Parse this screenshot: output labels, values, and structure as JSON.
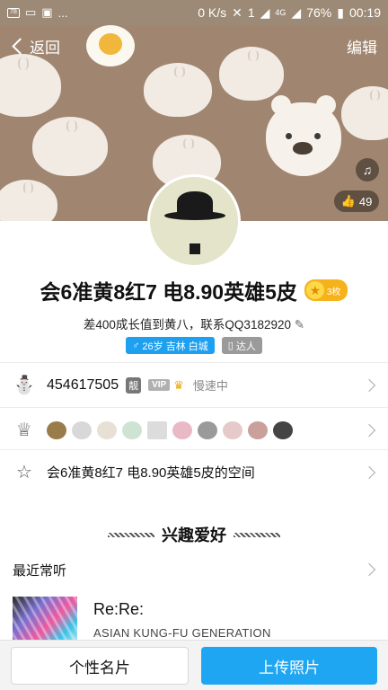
{
  "statusbar": {
    "net_speed": "0 K/s",
    "battery": "76%",
    "time": "00:19",
    "notif_count": "78",
    "ellipsis": "...",
    "sim_badge": "1",
    "net_type": "4G"
  },
  "nav": {
    "back_label": "返回",
    "edit_label": "编辑"
  },
  "cover": {
    "likes": "49"
  },
  "profile": {
    "name": "会6准黄8红7  电8.90英雄5皮",
    "medal_count": "3枚",
    "growth_text": "差400成长值到黄八，联系QQ3182920",
    "age_location": "26岁 吉林 白城",
    "tag_label": "达人"
  },
  "info_rows": {
    "qq_number": "454617505",
    "liang": "靓",
    "vip": "VIP",
    "speed_status": "慢速中",
    "space_label": "会6准黄8红7  电8.90英雄5皮的空间"
  },
  "interests": {
    "title": "兴趣爱好",
    "recent_label": "最近常听",
    "song": "Re:Re:",
    "artist": "ASIAN KUNG-FU GENERATION"
  },
  "bottom": {
    "card_label": "个性名片",
    "upload_label": "上传照片"
  },
  "colors": {
    "accent": "#1fa6f3",
    "cover": "#a08670",
    "gold": "#f6b21a"
  }
}
